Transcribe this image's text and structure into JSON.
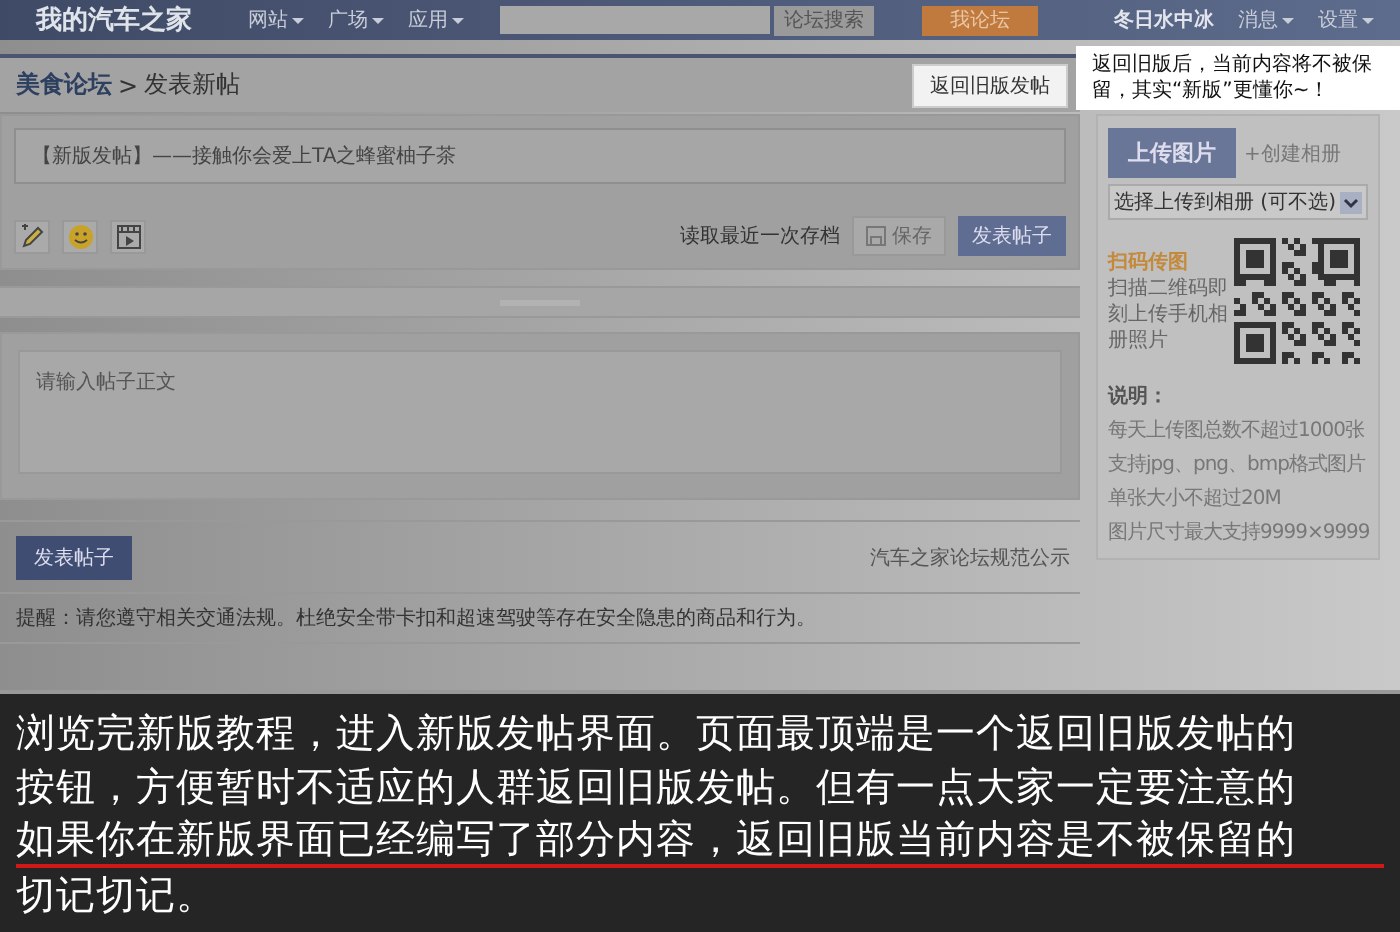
{
  "top_nav": {
    "logo": "我的汽车之家",
    "menus": [
      {
        "label": "网站"
      },
      {
        "label": "广场"
      },
      {
        "label": "应用"
      }
    ],
    "search_button": "论坛搜索",
    "my_forum_button": "我论坛",
    "username": "冬日水中冰",
    "user_menus": [
      {
        "label": "消息"
      },
      {
        "label": "设置"
      }
    ]
  },
  "breadcrumb": {
    "forum": "美食论坛",
    "separator": ">",
    "page": "发表新帖"
  },
  "old_version_button": "返回旧版发帖",
  "tooltip": "返回旧版后，当前内容将不被保留，其实“新版”更懂你~！",
  "editor": {
    "title_value": "【新版发帖】——接触你会爱上TA之蜂蜜柚子茶",
    "tools": [
      {
        "kind": "pencil"
      },
      {
        "kind": "emoji"
      },
      {
        "kind": "video"
      }
    ],
    "load_draft": "读取最近一次存档",
    "save_button": "保存",
    "publish_button": "发表帖子",
    "body_placeholder": "请输入帖子正文"
  },
  "footer": {
    "publish_button": "发表帖子",
    "rules_link": "汽车之家论坛规范公示",
    "notice": "提醒：请您遵守相关交通法规。杜绝安全带卡扣和超速驾驶等存在安全隐患的商品和行为。"
  },
  "upload_panel": {
    "upload_button": "上传图片",
    "create_album_link": "+创建相册",
    "album_select": "选择上传到相册 (可不选)",
    "qr_title": "扫码传图",
    "qr_text": "扫描二维码即刻上传手机相册照片",
    "notes_title": "说明：",
    "notes": [
      "每天上传图总数不超过1000张",
      "支持jpg、png、bmp格式图片",
      "单张大小不超过20M",
      "图片尺寸最大支持9999×9999"
    ]
  },
  "caption": [
    {
      "text": "浏览完新版教程，进入新版发帖界面。页面最顶端是一个返回旧版发帖的",
      "underlined": false
    },
    {
      "text": "按钮，方便暂时不适应的人群返回旧版发帖。但有一点大家一定要注意的",
      "underlined": false
    },
    {
      "text": "如果你在新版界面已经编写了部分内容，返回旧版当前内容是不被保留的",
      "underlined": true
    },
    {
      "text": "切记切记。",
      "underlined": false
    }
  ]
}
